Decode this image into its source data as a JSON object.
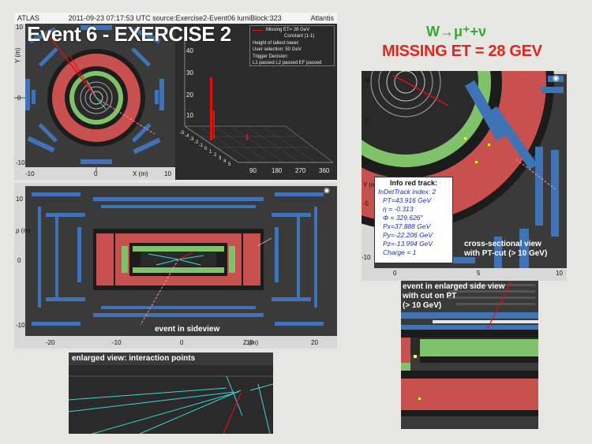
{
  "top_bar": {
    "left": "ATLAS",
    "center": "2011-09-23 07:17:53 UTC source:Exercise2-Event06 lumiBlock:323",
    "right": "Atlantis"
  },
  "slide_title": "Event 6 - EXERCISE 2",
  "decay_label": "W→μ⁺+ν",
  "missing_et_label": "MISSING ET = 28 GEV",
  "lego_legend": {
    "lines": [
      "Missing ET= 28 GeV",
      "Constant (1-1)",
      "Height of tallest tower:",
      "User selection: 50 GeV",
      "Trigger Decision:",
      "L1 passed L2 passed EF passed"
    ]
  },
  "xy_view": {
    "y_axis_title": "Y (m)",
    "x_axis_title": "X (m)",
    "y_ticks": [
      "10",
      "0",
      "-10"
    ],
    "x_ticks": [
      "-10",
      "0",
      "10"
    ]
  },
  "lego_view": {
    "z_ticks": [
      "40",
      "30",
      "20",
      "10"
    ],
    "phi_ticks": [
      "90",
      "180",
      "270",
      "360"
    ],
    "eta_ticks": [
      "-5",
      "-4",
      "-3",
      "-2",
      "-1",
      "0",
      "1",
      "2",
      "3",
      "4",
      "5"
    ]
  },
  "side_view": {
    "y_axis_title": "ρ (m)",
    "x_axis_title": "Z (m)",
    "x_ticks": [
      "-20",
      "-10",
      "0",
      "10",
      "20"
    ],
    "y_ticks": [
      "10",
      "0",
      "-10"
    ],
    "caption": "event in sideview"
  },
  "enlarged_ip_view": {
    "caption": "enlarged view: interaction points"
  },
  "zoom_xy_view": {
    "y_axis_title": "Y (m)",
    "y_ticks": [
      "10",
      "5",
      "0",
      "-5",
      "-10"
    ],
    "x_ticks": [
      "0",
      "5",
      "10"
    ],
    "caption_line1": "cross-sectional view",
    "caption_line2": "with PT-cut  (> 10 GeV)"
  },
  "track_info": {
    "title": "Info red track:",
    "lines": [
      "InDetTrack index: 2",
      "PT=43.916 GeV",
      "η = -0.313",
      "Φ = 329.626°",
      "Px=37.888 GeV",
      "Py=-22.206 GeV",
      "Pz=-13.994 GeV",
      "Charge = 1"
    ]
  },
  "enlarged_side_view": {
    "caption_line1": "event in enlarged side view",
    "caption_line2": "with cut on PT",
    "caption_line3": "(> 10 GeV)"
  },
  "colors": {
    "background": "#e6e6e2",
    "calo_red": "#c8504e",
    "calo_green": "#7fc26a",
    "muon_blue": "#3f73b5",
    "panel_dark": "#3a3a3a",
    "title_green": "#34a833",
    "title_red": "#e0261f",
    "track_red": "#e01010",
    "track_cyan": "#3fd6d6"
  }
}
